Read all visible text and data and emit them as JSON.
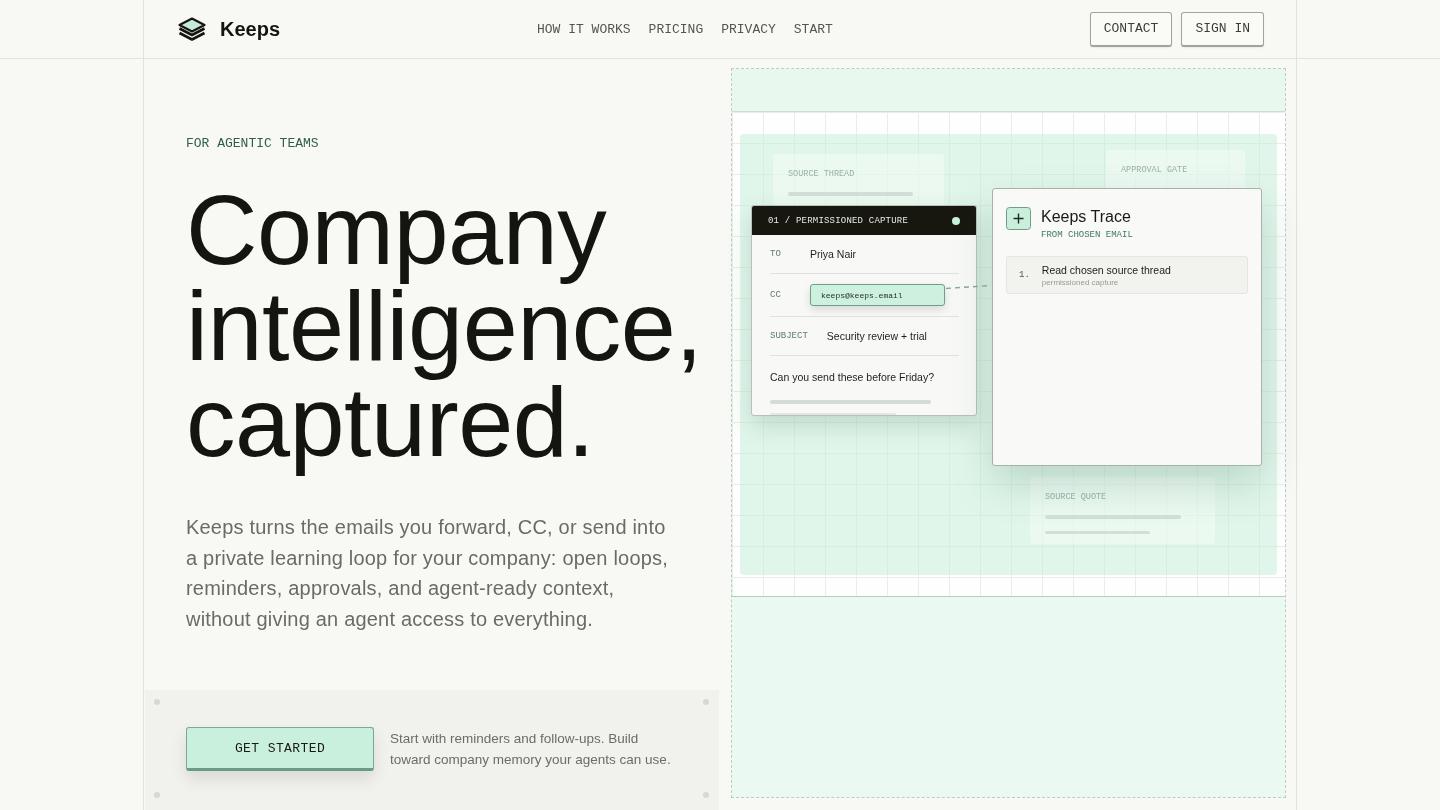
{
  "header": {
    "brand": "Keeps",
    "nav": [
      {
        "label": "HOW IT WORKS"
      },
      {
        "label": "PRICING"
      },
      {
        "label": "PRIVACY"
      },
      {
        "label": "START"
      }
    ],
    "actions": [
      {
        "label": "CONTACT"
      },
      {
        "label": "SIGN IN"
      }
    ]
  },
  "hero": {
    "eyebrow": "FOR AGENTIC TEAMS",
    "headline": "Company intelligence, captured.",
    "description": "Keeps turns the emails you forward, CC, or send into a private learning loop for your company: open loops, reminders, approvals, and agent-ready context, without giving an agent access to everything.",
    "cta": {
      "button": "GET STARTED",
      "note": "Start with reminders and follow-ups. Build toward company memory your agents can use."
    }
  },
  "illustration": {
    "ghost_cards": [
      {
        "label": "SOURCE THREAD"
      },
      {
        "label": "APPROVAL GATE"
      },
      {
        "label": "SOURCE QUOTE"
      }
    ],
    "email_card": {
      "header": "01 / PERMISSIONED CAPTURE",
      "fields": [
        {
          "kind": "text",
          "label": "TO",
          "value": "Priya Nair"
        },
        {
          "kind": "chip",
          "label": "CC",
          "value": "keeps@keeps.email"
        },
        {
          "kind": "text",
          "label": "SUBJECT",
          "value": "Security review + trial"
        }
      ],
      "body": "Can you send these before Friday?"
    },
    "trace_card": {
      "title": "Keeps Trace",
      "subtitle": "FROM CHOSEN EMAIL",
      "steps": [
        {
          "number": "1.",
          "title": "Read chosen source thread",
          "detail": "permissioned capture"
        }
      ]
    }
  }
}
